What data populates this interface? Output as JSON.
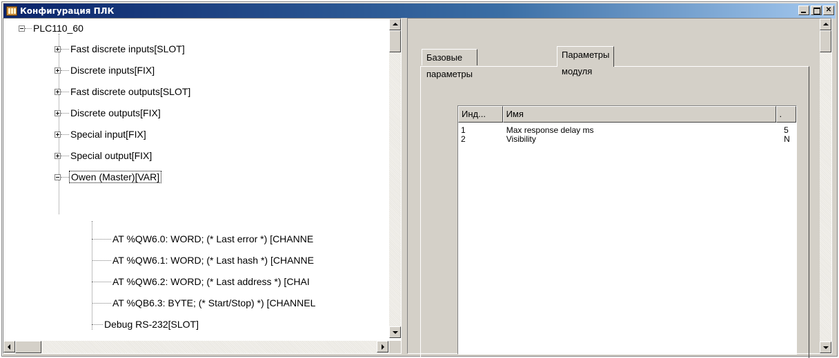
{
  "window": {
    "title": "Конфигурация ПЛК"
  },
  "tree": {
    "root": "PLC110_60",
    "items": [
      {
        "label": "Fast discrete inputs[SLOT]",
        "expander": "plus"
      },
      {
        "label": "Discrete inputs[FIX]",
        "expander": "plus"
      },
      {
        "label": "Fast discrete outputs[SLOT]",
        "expander": "plus"
      },
      {
        "label": "Discrete outputs[FIX]",
        "expander": "plus"
      },
      {
        "label": "Special input[FIX]",
        "expander": "plus"
      },
      {
        "label": "Special output[FIX]",
        "expander": "plus"
      },
      {
        "label": "Owen (Master)[VAR]",
        "expander": "minus",
        "selected": true
      }
    ],
    "children": [
      "AT %QW6.0: WORD; (* Last error *) [CHANNE",
      "AT %QW6.1: WORD; (* Last hash *) [CHANNE",
      "AT %QW6.2: WORD; (* Last address *) [CHAI",
      "AT %QB6.3: BYTE; (* Start/Stop) *) [CHANNEL",
      "Debug RS-232[SLOT]"
    ]
  },
  "tabs": [
    {
      "label": "Базовые параметры"
    },
    {
      "label": "Параметры модуля",
      "active": true
    }
  ],
  "params_list": {
    "columns": [
      "Инд...",
      "Имя",
      "."
    ],
    "rows": [
      {
        "index": "1",
        "name": "Max response delay ms",
        "value": "5"
      },
      {
        "index": "2",
        "name": "Visibility",
        "value": "N"
      }
    ]
  }
}
